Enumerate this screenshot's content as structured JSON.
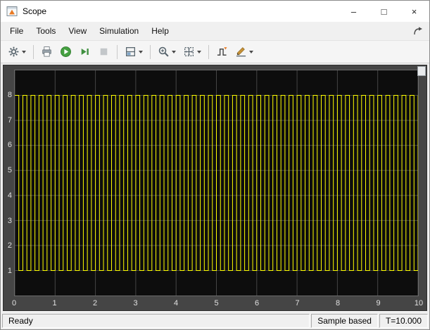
{
  "window": {
    "title": "Scope",
    "controls": {
      "minimize": "–",
      "maximize": "□",
      "close": "×"
    }
  },
  "menu": {
    "items": [
      "File",
      "Tools",
      "View",
      "Simulation",
      "Help"
    ]
  },
  "toolbar": {
    "buttons": [
      {
        "icon": "gear-icon",
        "split": true
      },
      {
        "icon": "print-icon",
        "split": false
      },
      {
        "icon": "run-icon",
        "split": false
      },
      {
        "icon": "step-forward-icon",
        "split": false
      },
      {
        "icon": "stop-icon",
        "split": false,
        "disabled": true
      },
      {
        "icon": "layout-icon",
        "split": true
      },
      {
        "icon": "zoom-icon",
        "split": true
      },
      {
        "icon": "fit-to-view-icon",
        "split": true
      },
      {
        "icon": "trigger-icon",
        "split": false
      },
      {
        "icon": "measurements-icon",
        "split": true
      }
    ]
  },
  "statusbar": {
    "state": "Ready",
    "mode": "Sample based",
    "time": "T=10.000"
  },
  "chart_data": {
    "type": "line",
    "title": "",
    "waveform": "pulse",
    "t_start": 0,
    "t_end": 10,
    "period": 0.2,
    "duty": 0.5,
    "high": 8,
    "low": 1,
    "initial": "high",
    "xlim": [
      0,
      10
    ],
    "ylim": [
      0,
      9
    ],
    "x_ticks": [
      0,
      1,
      2,
      3,
      4,
      5,
      6,
      7,
      8,
      9,
      10
    ],
    "y_ticks": [
      1,
      2,
      3,
      4,
      5,
      6,
      7,
      8
    ],
    "grid": true,
    "line_color": "#ffff00",
    "background": "#0d0d0d",
    "grid_color": "#454545",
    "tick_color": "#e0e0e0"
  }
}
